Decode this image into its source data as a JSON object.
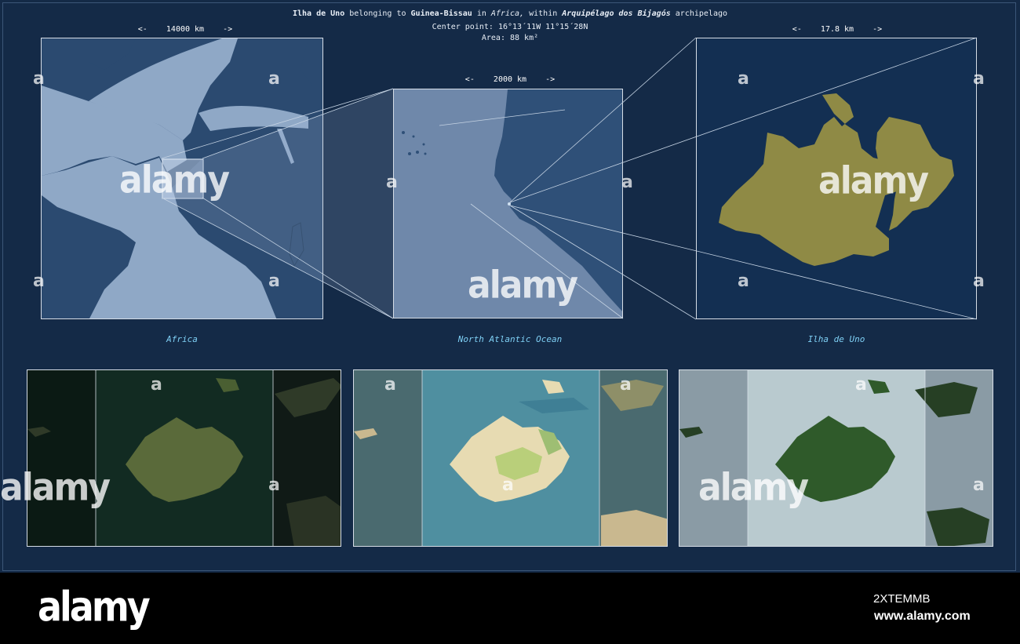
{
  "header": {
    "name": "Ilha de Uno",
    "belonging": "belonging to",
    "country": "Guinea-Bissau",
    "in": "in",
    "continent": "Africa,",
    "within": "within",
    "archipelago": "Arquipélago dos Bijagós",
    "archipelago_word": "archipelago",
    "center_label": "Center point:",
    "center_value": "16°13´11W  11°15´28N",
    "area_label": "Area:",
    "area_value": "88 km²"
  },
  "panels": {
    "africa": {
      "scale": "<-    14000 km    ->",
      "caption": "Africa"
    },
    "ocean": {
      "scale": "<-    2000 km    ->",
      "caption": "North Atlantic Ocean"
    },
    "island": {
      "scale": "<-    17.8 km    ->",
      "caption": "Ilha de Uno"
    }
  },
  "watermark": {
    "text": "alamy",
    "small": "a"
  },
  "colors": {
    "background": "#142a47",
    "land_dark": "#2b4a70",
    "land_light": "#8fa8c6",
    "island_fill": "#8f8a45",
    "caption": "#7fd0f5"
  },
  "footer": {
    "logo": "alamy",
    "image_code": "2XTEMMB",
    "site": "www.alamy.com"
  }
}
